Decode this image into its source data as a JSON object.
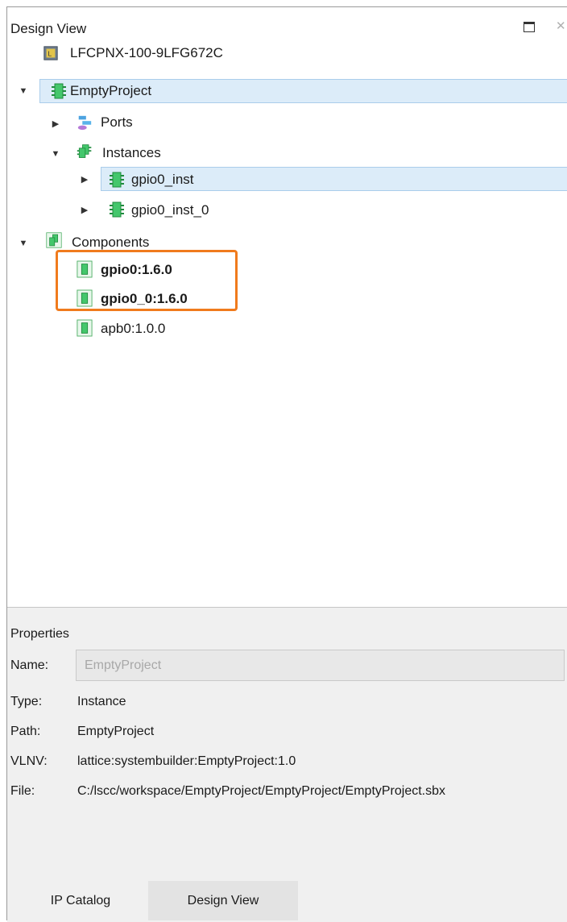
{
  "panel": {
    "title": "Design View"
  },
  "tree": {
    "device": "LFCPNX-100-9LFG672C",
    "project": "EmptyProject",
    "ports": "Ports",
    "instances": "Instances",
    "instance_items": [
      "gpio0_inst",
      "gpio0_inst_0"
    ],
    "components": "Components",
    "component_items": [
      "gpio0:1.6.0",
      "gpio0_0:1.6.0",
      "apb0:1.0.0"
    ]
  },
  "properties": {
    "title": "Properties",
    "name_label": "Name:",
    "name_value": "EmptyProject",
    "type_label": "Type:",
    "type_value": "Instance",
    "path_label": "Path:",
    "path_value": "EmptyProject",
    "vlnv_label": "VLNV:",
    "vlnv_value": "lattice:systembuilder:EmptyProject:1.0",
    "file_label": "File:",
    "file_value": "C:/lscc/workspace/EmptyProject/EmptyProject/EmptyProject.sbx"
  },
  "tabs": [
    "IP Catalog",
    "Design View"
  ],
  "colors": {
    "selection": "#dcecf9",
    "highlight": "#f07b1d",
    "chip_green": "#3ec86a"
  }
}
